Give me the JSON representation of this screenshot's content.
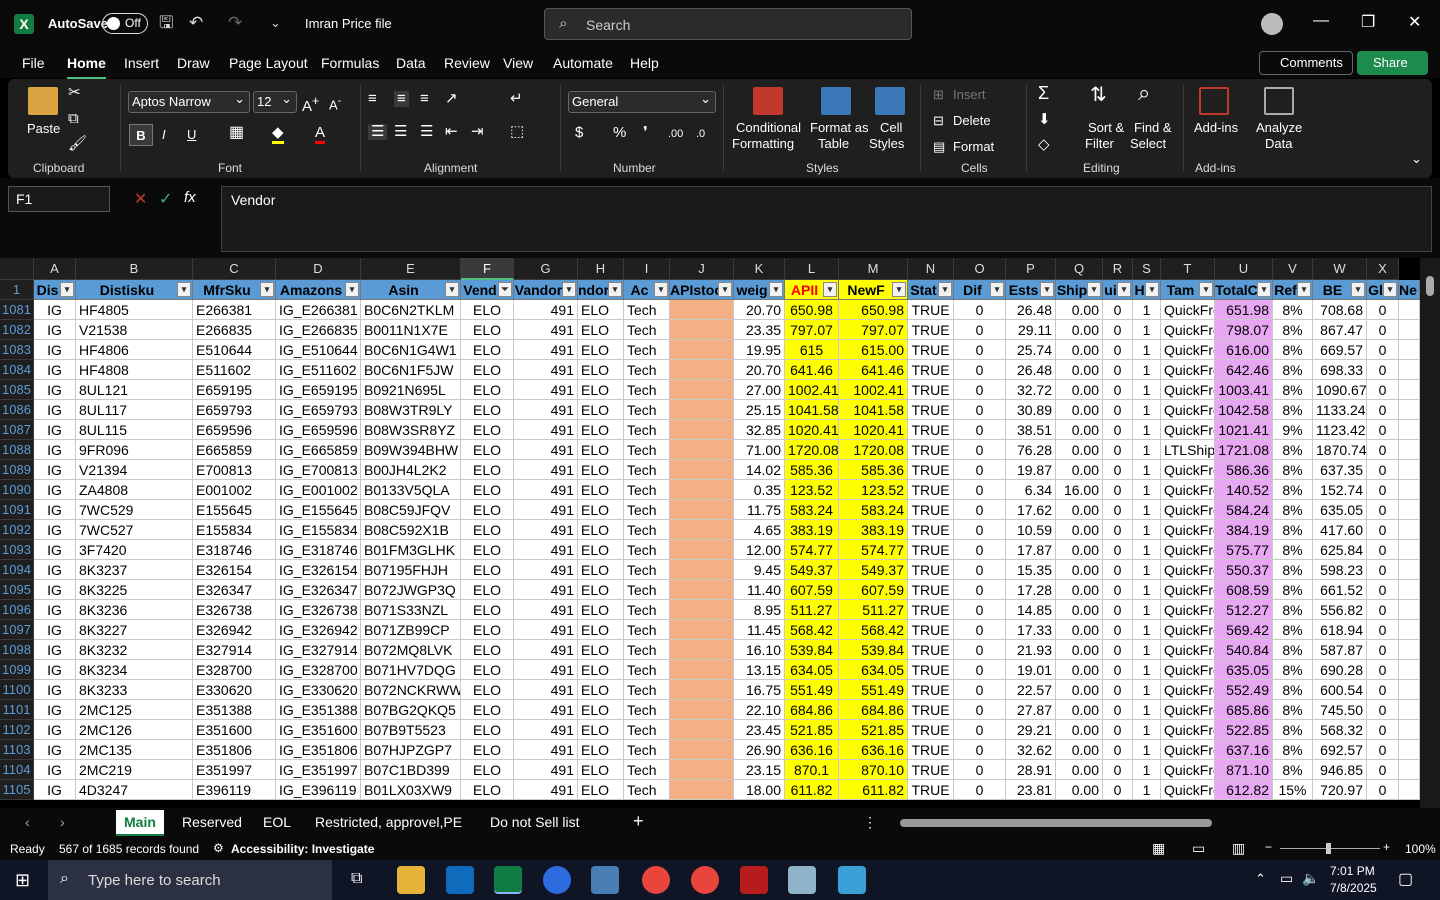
{
  "title_bar": {
    "autosave_label": "AutoSave",
    "autosave_state": "Off",
    "file_title": "Imran Price file",
    "search_placeholder": "Search"
  },
  "menu_tabs": [
    "File",
    "Home",
    "Insert",
    "Draw",
    "Page Layout",
    "Formulas",
    "Data",
    "Review",
    "View",
    "Automate",
    "Help"
  ],
  "comments_label": "Comments",
  "share_label": "Share",
  "ribbon": {
    "paste": "Paste",
    "groups": {
      "clipboard": "Clipboard",
      "font": "Font",
      "alignment": "Alignment",
      "number": "Number",
      "styles": "Styles",
      "cells": "Cells",
      "editing": "Editing",
      "addins": "Add-ins"
    },
    "font_name": "Aptos Narrow",
    "font_size": "12",
    "number_format": "General",
    "conditional_formatting": [
      "Conditional",
      "Formatting"
    ],
    "format_as_table": [
      "Format as",
      "Table"
    ],
    "cell_styles": [
      "Cell",
      "Styles"
    ],
    "insert": "Insert",
    "delete": "Delete",
    "format": "Format",
    "sort_filter": [
      "Sort &",
      "Filter"
    ],
    "find_select": [
      "Find &",
      "Select"
    ],
    "addins_btn": "Add-ins",
    "analyze": [
      "Analyze",
      "Data"
    ]
  },
  "formula_bar": {
    "name_box": "F1",
    "content": "Vendor"
  },
  "column_letters": [
    "A",
    "B",
    "C",
    "D",
    "E",
    "F",
    "G",
    "H",
    "I",
    "J",
    "K",
    "L",
    "M",
    "N",
    "O",
    "P",
    "Q",
    "R",
    "S",
    "T",
    "U",
    "V",
    "W",
    "X"
  ],
  "header_row_number": "1",
  "headers": [
    "Dis",
    "Distisku",
    "MfrSku",
    "Amazons",
    "Asin",
    "Vend",
    "Vandor",
    "ndor",
    "Ac",
    "APIstoc",
    "weig",
    "APII",
    "NewF",
    "Stat",
    "Dif",
    "Ests",
    "Ship",
    "ui",
    "H",
    "Tam",
    "TotalC",
    "Ref",
    "BE",
    "Gl",
    "Ne"
  ],
  "rows": [
    [
      "1081",
      "IG",
      "HF4805",
      "E266381",
      "IG_E266381",
      "B0C6N2TKLM",
      "ELO",
      "491",
      "ELO",
      "Tech",
      "",
      "20.70",
      "650.98",
      "650.98",
      "TRUE",
      "0",
      "26.48",
      "0.00",
      "0",
      "1",
      "QuickFre",
      "651.98",
      "8%",
      "708.68",
      "0"
    ],
    [
      "1082",
      "IG",
      "V21538",
      "E266835",
      "IG_E266835",
      "B0011N1X7E",
      "ELO",
      "491",
      "ELO",
      "Tech",
      "",
      "23.35",
      "797.07",
      "797.07",
      "TRUE",
      "0",
      "29.11",
      "0.00",
      "0",
      "1",
      "QuickFre",
      "798.07",
      "8%",
      "867.47",
      "0"
    ],
    [
      "1083",
      "IG",
      "HF4806",
      "E510644",
      "IG_E510644",
      "B0C6N1G4W1",
      "ELO",
      "491",
      "ELO",
      "Tech",
      "",
      "19.95",
      "615",
      "615.00",
      "TRUE",
      "0",
      "25.74",
      "0.00",
      "0",
      "1",
      "QuickFre",
      "616.00",
      "8%",
      "669.57",
      "0"
    ],
    [
      "1084",
      "IG",
      "HF4808",
      "E511602",
      "IG_E511602",
      "B0C6N1F5JW",
      "ELO",
      "491",
      "ELO",
      "Tech",
      "",
      "20.70",
      "641.46",
      "641.46",
      "TRUE",
      "0",
      "26.48",
      "0.00",
      "0",
      "1",
      "QuickFre",
      "642.46",
      "8%",
      "698.33",
      "0"
    ],
    [
      "1085",
      "IG",
      "8UL121",
      "E659195",
      "IG_E659195",
      "B0921N695L",
      "ELO",
      "491",
      "ELO",
      "Tech",
      "",
      "27.00",
      "1002.41",
      "1002.41",
      "TRUE",
      "0",
      "32.72",
      "0.00",
      "0",
      "1",
      "QuickFre",
      "1003.41",
      "8%",
      "1090.67",
      "0"
    ],
    [
      "1086",
      "IG",
      "8UL117",
      "E659793",
      "IG_E659793",
      "B08W3TR9LY",
      "ELO",
      "491",
      "ELO",
      "Tech",
      "",
      "25.15",
      "1041.58",
      "1041.58",
      "TRUE",
      "0",
      "30.89",
      "0.00",
      "0",
      "1",
      "QuickFre",
      "1042.58",
      "8%",
      "1133.24",
      "0"
    ],
    [
      "1087",
      "IG",
      "8UL115",
      "E659596",
      "IG_E659596",
      "B08W3SR8YZ",
      "ELO",
      "491",
      "ELO",
      "Tech",
      "",
      "32.85",
      "1020.41",
      "1020.41",
      "TRUE",
      "0",
      "38.51",
      "0.00",
      "0",
      "1",
      "QuickFre",
      "1021.41",
      "9%",
      "1123.42",
      "0"
    ],
    [
      "1088",
      "IG",
      "9FR096",
      "E665859",
      "IG_E665859",
      "B09W394BHW",
      "ELO",
      "491",
      "ELO",
      "Tech",
      "",
      "71.00",
      "1720.08",
      "1720.08",
      "TRUE",
      "0",
      "76.28",
      "0.00",
      "0",
      "1",
      "LTLShipp",
      "1721.08",
      "8%",
      "1870.74",
      "0"
    ],
    [
      "1089",
      "IG",
      "V21394",
      "E700813",
      "IG_E700813",
      "B00JH4L2K2",
      "ELO",
      "491",
      "ELO",
      "Tech",
      "",
      "14.02",
      "585.36",
      "585.36",
      "TRUE",
      "0",
      "19.87",
      "0.00",
      "0",
      "1",
      "QuickFre",
      "586.36",
      "8%",
      "637.35",
      "0"
    ],
    [
      "1090",
      "IG",
      "ZA4808",
      "E001002",
      "IG_E001002",
      "B0133V5QLA",
      "ELO",
      "491",
      "ELO",
      "Tech",
      "",
      "0.35",
      "123.52",
      "123.52",
      "TRUE",
      "0",
      "6.34",
      "16.00",
      "0",
      "1",
      "QuickFre",
      "140.52",
      "8%",
      "152.74",
      "0"
    ],
    [
      "1091",
      "IG",
      "7WC529",
      "E155645",
      "IG_E155645",
      "B08C59JFQV",
      "ELO",
      "491",
      "ELO",
      "Tech",
      "",
      "11.75",
      "583.24",
      "583.24",
      "TRUE",
      "0",
      "17.62",
      "0.00",
      "0",
      "1",
      "QuickFre",
      "584.24",
      "8%",
      "635.05",
      "0"
    ],
    [
      "1092",
      "IG",
      "7WC527",
      "E155834",
      "IG_E155834",
      "B08C592X1B",
      "ELO",
      "491",
      "ELO",
      "Tech",
      "",
      "4.65",
      "383.19",
      "383.19",
      "TRUE",
      "0",
      "10.59",
      "0.00",
      "0",
      "1",
      "QuickFre",
      "384.19",
      "8%",
      "417.60",
      "0"
    ],
    [
      "1093",
      "IG",
      "3F7420",
      "E318746",
      "IG_E318746",
      "B01FM3GLHK",
      "ELO",
      "491",
      "ELO",
      "Tech",
      "",
      "12.00",
      "574.77",
      "574.77",
      "TRUE",
      "0",
      "17.87",
      "0.00",
      "0",
      "1",
      "QuickFre",
      "575.77",
      "8%",
      "625.84",
      "0"
    ],
    [
      "1094",
      "IG",
      "8K3237",
      "E326154",
      "IG_E326154",
      "B07195FHJH",
      "ELO",
      "491",
      "ELO",
      "Tech",
      "",
      "9.45",
      "549.37",
      "549.37",
      "TRUE",
      "0",
      "15.35",
      "0.00",
      "0",
      "1",
      "QuickFre",
      "550.37",
      "8%",
      "598.23",
      "0"
    ],
    [
      "1095",
      "IG",
      "8K3225",
      "E326347",
      "IG_E326347",
      "B072JWGP3Q",
      "ELO",
      "491",
      "ELO",
      "Tech",
      "",
      "11.40",
      "607.59",
      "607.59",
      "TRUE",
      "0",
      "17.28",
      "0.00",
      "0",
      "1",
      "QuickFre",
      "608.59",
      "8%",
      "661.52",
      "0"
    ],
    [
      "1096",
      "IG",
      "8K3236",
      "E326738",
      "IG_E326738",
      "B071S33NZL",
      "ELO",
      "491",
      "ELO",
      "Tech",
      "",
      "8.95",
      "511.27",
      "511.27",
      "TRUE",
      "0",
      "14.85",
      "0.00",
      "0",
      "1",
      "QuickFre",
      "512.27",
      "8%",
      "556.82",
      "0"
    ],
    [
      "1097",
      "IG",
      "8K3227",
      "E326942",
      "IG_E326942",
      "B071ZB99CP",
      "ELO",
      "491",
      "ELO",
      "Tech",
      "",
      "11.45",
      "568.42",
      "568.42",
      "TRUE",
      "0",
      "17.33",
      "0.00",
      "0",
      "1",
      "QuickFre",
      "569.42",
      "8%",
      "618.94",
      "0"
    ],
    [
      "1098",
      "IG",
      "8K3232",
      "E327914",
      "IG_E327914",
      "B072MQ8LVK",
      "ELO",
      "491",
      "ELO",
      "Tech",
      "",
      "16.10",
      "539.84",
      "539.84",
      "TRUE",
      "0",
      "21.93",
      "0.00",
      "0",
      "1",
      "QuickFre",
      "540.84",
      "8%",
      "587.87",
      "0"
    ],
    [
      "1099",
      "IG",
      "8K3234",
      "E328700",
      "IG_E328700",
      "B071HV7DQG",
      "ELO",
      "491",
      "ELO",
      "Tech",
      "",
      "13.15",
      "634.05",
      "634.05",
      "TRUE",
      "0",
      "19.01",
      "0.00",
      "0",
      "1",
      "QuickFre",
      "635.05",
      "8%",
      "690.28",
      "0"
    ],
    [
      "1100",
      "IG",
      "8K3233",
      "E330620",
      "IG_E330620",
      "B072NCKRWW",
      "ELO",
      "491",
      "ELO",
      "Tech",
      "",
      "16.75",
      "551.49",
      "551.49",
      "TRUE",
      "0",
      "22.57",
      "0.00",
      "0",
      "1",
      "QuickFre",
      "552.49",
      "8%",
      "600.54",
      "0"
    ],
    [
      "1101",
      "IG",
      "2MC125",
      "E351388",
      "IG_E351388",
      "B07BG2QKQ5",
      "ELO",
      "491",
      "ELO",
      "Tech",
      "",
      "22.10",
      "684.86",
      "684.86",
      "TRUE",
      "0",
      "27.87",
      "0.00",
      "0",
      "1",
      "QuickFre",
      "685.86",
      "8%",
      "745.50",
      "0"
    ],
    [
      "1102",
      "IG",
      "2MC126",
      "E351600",
      "IG_E351600",
      "B07B9T5523",
      "ELO",
      "491",
      "ELO",
      "Tech",
      "",
      "23.45",
      "521.85",
      "521.85",
      "TRUE",
      "0",
      "29.21",
      "0.00",
      "0",
      "1",
      "QuickFre",
      "522.85",
      "8%",
      "568.32",
      "0"
    ],
    [
      "1103",
      "IG",
      "2MC135",
      "E351806",
      "IG_E351806",
      "B07HJPZGP7",
      "ELO",
      "491",
      "ELO",
      "Tech",
      "",
      "26.90",
      "636.16",
      "636.16",
      "TRUE",
      "0",
      "32.62",
      "0.00",
      "0",
      "1",
      "QuickFre",
      "637.16",
      "8%",
      "692.57",
      "0"
    ],
    [
      "1104",
      "IG",
      "2MC219",
      "E351997",
      "IG_E351997",
      "B07C1BD399",
      "ELO",
      "491",
      "ELO",
      "Tech",
      "",
      "23.15",
      "870.1",
      "870.10",
      "TRUE",
      "0",
      "28.91",
      "0.00",
      "0",
      "1",
      "QuickFre",
      "871.10",
      "8%",
      "946.85",
      "0"
    ],
    [
      "1105",
      "IG",
      "4D3247",
      "E396119",
      "IG_E396119",
      "B01LX03XW9",
      "ELO",
      "491",
      "ELO",
      "Tech",
      "",
      "18.00",
      "611.82",
      "611.82",
      "TRUE",
      "0",
      "23.81",
      "0.00",
      "0",
      "1",
      "QuickFre",
      "612.82",
      "15%",
      "720.97",
      "0"
    ]
  ],
  "sheet_tabs": [
    "Main",
    "Reserved",
    "EOL",
    "Restricted, approvel,PE",
    "Do not Sell list"
  ],
  "status": {
    "ready": "Ready",
    "records": "567 of 1685 records found",
    "accessibility": "Accessibility: Investigate",
    "zoom": "100%"
  },
  "taskbar": {
    "search_placeholder": "Type here to search",
    "time": "7:01 PM",
    "date": "7/8/2025"
  },
  "colors": {
    "header_blue": "#5b9bd5",
    "yellow": "#ffff00",
    "pink": "#f4b084",
    "purple": "#e8a7f2",
    "excel_green": "#107c41"
  }
}
